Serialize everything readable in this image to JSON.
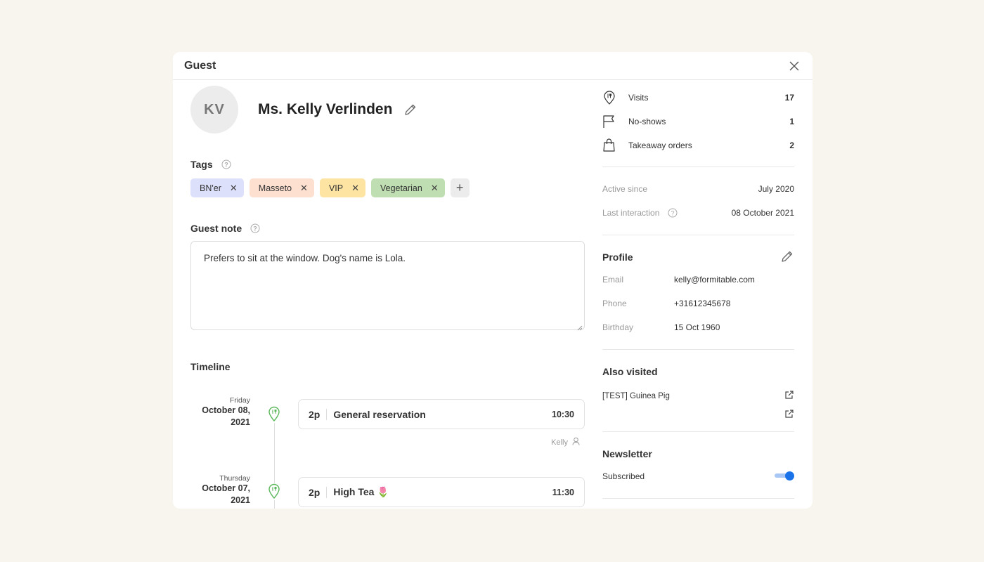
{
  "modal": {
    "title": "Guest"
  },
  "guest": {
    "initials": "KV",
    "name": "Ms. Kelly Verlinden"
  },
  "tags": {
    "label": "Tags",
    "items": [
      {
        "label": "BN'er",
        "color": "#dde0fa"
      },
      {
        "label": "Masseto",
        "color": "#fde0d0"
      },
      {
        "label": "VIP",
        "color": "#fde4a3"
      },
      {
        "label": "Vegetarian",
        "color": "#bfdfb2"
      }
    ],
    "add": "+"
  },
  "note": {
    "label": "Guest note",
    "text": "Prefers to sit at the window. Dog's name is Lola."
  },
  "timeline": {
    "label": "Timeline",
    "entries": [
      {
        "weekday": "Friday",
        "date": "October 08, 2021",
        "party": "2p",
        "title": "General reservation",
        "time": "10:30",
        "author": "Kelly",
        "icon": "reservation-pin-icon"
      },
      {
        "weekday": "Thursday",
        "date": "October 07, 2021",
        "party": "2p",
        "title": "High Tea 🌷",
        "time": "11:30",
        "icon": "reservation-pin-icon"
      }
    ]
  },
  "stats": [
    {
      "icon": "visits-pin-icon",
      "label": "Visits",
      "value": "17"
    },
    {
      "icon": "flag-icon",
      "label": "No-shows",
      "value": "1"
    },
    {
      "icon": "shopping-bag-icon",
      "label": "Takeaway orders",
      "value": "2"
    }
  ],
  "activity": {
    "active_since_label": "Active since",
    "active_since": "July 2020",
    "last_interaction_label": "Last interaction",
    "last_interaction": "08 October 2021"
  },
  "profile": {
    "title": "Profile",
    "fields": [
      {
        "key": "Email",
        "value": "kelly@formitable.com"
      },
      {
        "key": "Phone",
        "value": "+31612345678"
      },
      {
        "key": "Birthday",
        "value": "15 Oct 1960"
      }
    ]
  },
  "also_visited": {
    "title": "Also visited",
    "items": [
      "[TEST] Guinea Pig",
      ""
    ]
  },
  "newsletter": {
    "title": "Newsletter",
    "status": "Subscribed",
    "subscribed": true
  },
  "colors": {
    "accent": "#1a73e8",
    "pin_green": "#5cb85c"
  }
}
